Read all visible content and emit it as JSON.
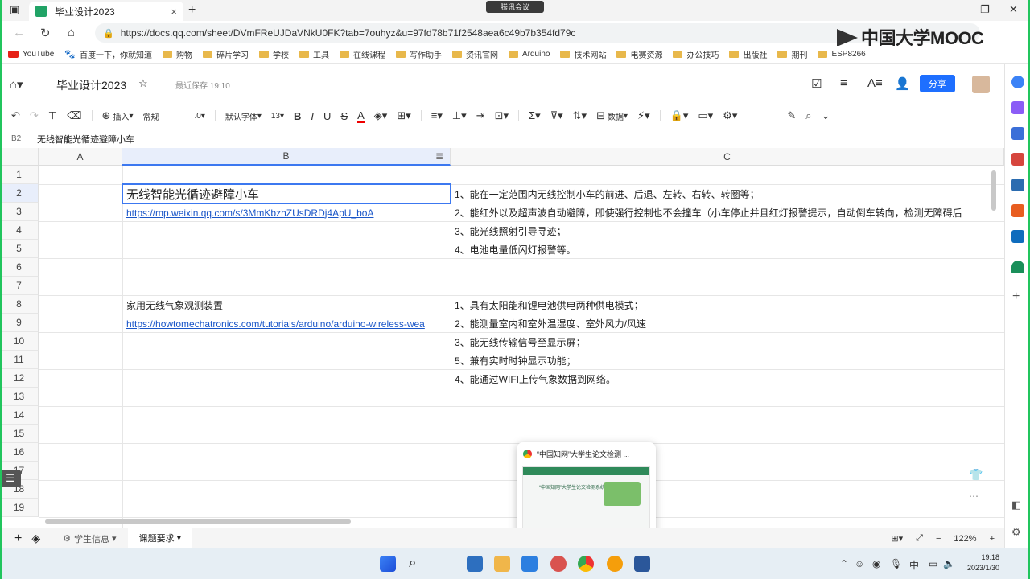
{
  "browser": {
    "tab_title": "毕业设计2023",
    "tab_close": "×",
    "new_tab": "+",
    "url": "https://docs.qq.com/sheet/DVmFReUJDaVNkU0FK?tab=7ouhyz&u=97fd78b71f2548aea6c49b7b354fd79c",
    "meeting_label": "腾讯会议",
    "watermark": "中国大学MOOC",
    "bookmarks": [
      "YouTube",
      "百度一下，你就知道",
      "购物",
      "碎片学习",
      "学校",
      "工具",
      "在线课程",
      "写作助手",
      "资讯官网",
      "Arduino",
      "技术网站",
      "电赛资源",
      "办公技巧",
      "出版社",
      "期刊",
      "ESP8266"
    ]
  },
  "doc": {
    "title": "毕业设计2023",
    "save_status": "最近保存 19:10",
    "share_label": "分享"
  },
  "toolbar": {
    "insert": "插入",
    "format": "常规",
    "decimal": ".0",
    "font": "默认字体",
    "font_size": "13",
    "bold": "B",
    "italic": "I",
    "underline": "U",
    "strike": "S",
    "text_color": "A",
    "data": "数据"
  },
  "formula": {
    "cell_ref": "B2",
    "content": "无线智能光循迹避障小车"
  },
  "grid": {
    "columns": [
      "A",
      "B",
      "C"
    ],
    "rows": [
      "1",
      "2",
      "3",
      "4",
      "5",
      "6",
      "7",
      "8",
      "9",
      "10",
      "11",
      "12",
      "13",
      "14",
      "15",
      "16",
      "17",
      "18",
      "19"
    ],
    "b2": "无线智能光循迹避障小车",
    "b3": "https://mp.weixin.qq.com/s/3MmKbzhZUsDRDj4ApU_boA",
    "b8": "家用无线气象观测装置",
    "b9": "https://howtomechatronics.com/tutorials/arduino/arduino-wireless-wea",
    "c2": "1、能在一定范围内无线控制小车的前进、后退、左转、右转、转圈等；",
    "c3": "2、能红外以及超声波自动避障，即使强行控制也不会撞车（小车停止并且红灯报警提示，自动倒车转向，检测无障碍后",
    "c4": "3、能光线照射引导寻迹；",
    "c5": "4、电池电量低闪灯报警等。",
    "c8": "1、具有太阳能和锂电池供电两种供电模式；",
    "c9": "2、能测量室内和室外温湿度、室外风力/风速",
    "c10": "3、能无线传输信号至显示屏；",
    "c11": "5、兼有实时时钟显示功能；",
    "c12": "4、能通过WIFI上传气象数据到网络。"
  },
  "popup": {
    "title": "“中国知网”大学生论文检测 ...",
    "preview_text": "“中国知网”大学生论文检测系统"
  },
  "sheets": {
    "tabs": [
      "学生信息",
      "课题要求"
    ],
    "zoom": "122%"
  },
  "taskbar": {
    "ime": "中",
    "time": "19:18",
    "date": "2023/1/30"
  }
}
